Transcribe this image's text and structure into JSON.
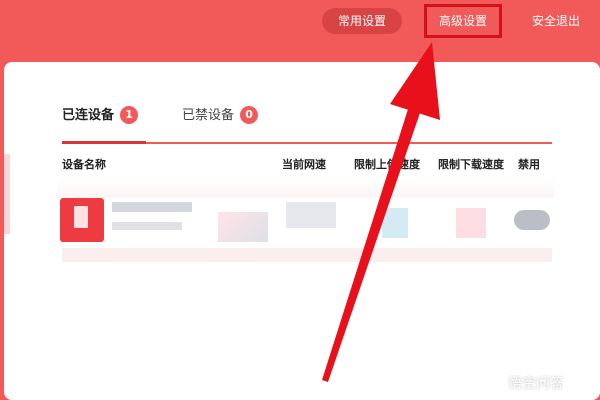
{
  "header": {
    "nav_common": "常用设置",
    "nav_advanced": "高级设置",
    "nav_logout": "安全退出"
  },
  "tabs": [
    {
      "label": "已连设备",
      "count": "1",
      "active": true
    },
    {
      "label": "已禁设备",
      "count": "0",
      "active": false
    }
  ],
  "table": {
    "columns": [
      "设备名称",
      "当前网速",
      "限制上传速度",
      "限制下载速度",
      "禁用"
    ]
  },
  "watermark": "悟空问答",
  "colors": {
    "brand": "#f25a5a",
    "highlight_box": "#d4101a",
    "arrow": "#e8101a"
  },
  "icons": {
    "watermark": "chat-bubble-icon",
    "device": "device-avatar"
  }
}
